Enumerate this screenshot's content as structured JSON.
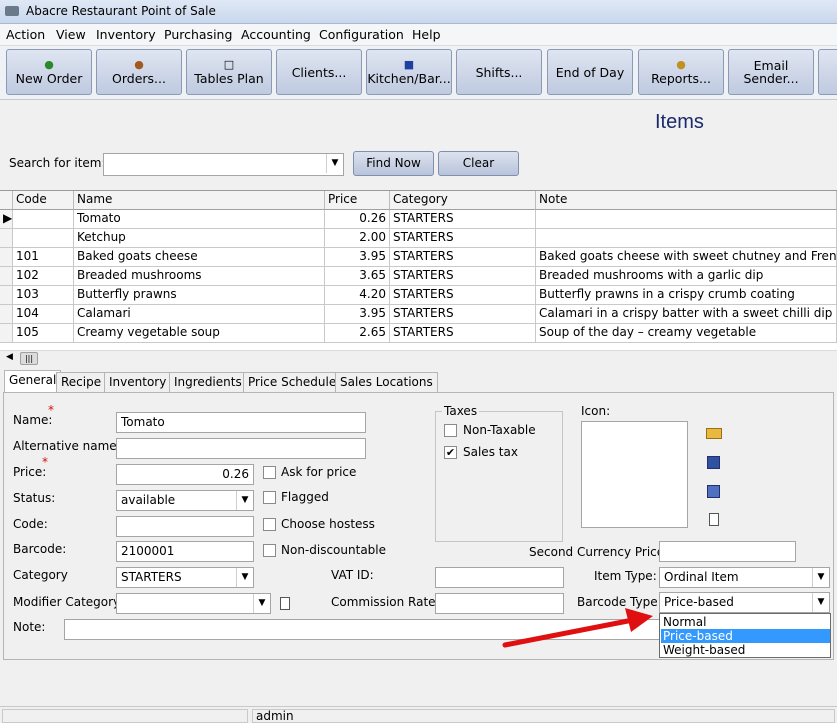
{
  "window": {
    "title": "Abacre Restaurant Point of Sale"
  },
  "menu": [
    "Action",
    "View",
    "Inventory",
    "Purchasing",
    "Accounting",
    "Configuration",
    "Help"
  ],
  "toolbar": [
    {
      "label": "New Order",
      "icon": "new-order-icon"
    },
    {
      "label": "Orders...",
      "icon": "orders-icon"
    },
    {
      "label": "Tables Plan",
      "icon": "tables-plan-icon"
    },
    {
      "label": "Clients...",
      "icon": ""
    },
    {
      "label": "Kitchen/Bar...",
      "icon": "kitchen-icon"
    },
    {
      "label": "Shifts...",
      "icon": ""
    },
    {
      "label": "End of Day",
      "icon": ""
    },
    {
      "label": "Reports...",
      "icon": "reports-icon"
    },
    {
      "label": "Email Sender...",
      "icon": ""
    }
  ],
  "page_title": "Items",
  "search": {
    "label": "Search for item:",
    "value": "",
    "find_label": "Find Now",
    "clear_label": "Clear"
  },
  "grid": {
    "columns": [
      "Code",
      "Name",
      "Price",
      "Category",
      "Note"
    ],
    "rows": [
      {
        "code": "",
        "name": "Tomato",
        "price": "0.26",
        "category": "STARTERS",
        "note": ""
      },
      {
        "code": "",
        "name": "Ketchup",
        "price": "2.00",
        "category": "STARTERS",
        "note": ""
      },
      {
        "code": "101",
        "name": "Baked goats cheese",
        "price": "3.95",
        "category": "STARTERS",
        "note": "Baked goats cheese with sweet chutney and French b"
      },
      {
        "code": "102",
        "name": "Breaded mushrooms",
        "price": "3.65",
        "category": "STARTERS",
        "note": "Breaded mushrooms with a garlic dip"
      },
      {
        "code": "103",
        "name": "Butterfly prawns",
        "price": "4.20",
        "category": "STARTERS",
        "note": "Butterfly prawns in a crispy crumb coating"
      },
      {
        "code": "104",
        "name": "Calamari",
        "price": "3.95",
        "category": "STARTERS",
        "note": "Calamari in a crispy batter with a sweet chilli dip"
      },
      {
        "code": "105",
        "name": "Creamy vegetable soup",
        "price": "2.65",
        "category": "STARTERS",
        "note": "Soup of the day – creamy vegetable"
      }
    ]
  },
  "tabs": [
    "General",
    "Recipe",
    "Inventory",
    "Ingredients",
    "Price Schedule",
    "Sales Locations"
  ],
  "form": {
    "name_label": "Name:",
    "name_value": "Tomato",
    "alt_name_label": "Alternative name:",
    "alt_name_value": "",
    "price_label": "Price:",
    "price_value": "0.26",
    "status_label": "Status:",
    "status_value": "available",
    "code_label": "Code:",
    "code_value": "",
    "barcode_label": "Barcode:",
    "barcode_value": "2100001",
    "category_label": "Category",
    "category_value": "STARTERS",
    "modifier_label": "Modifier Category:",
    "modifier_value": "",
    "note_label": "Note:",
    "note_value": "",
    "ask_price": "Ask for price",
    "flagged": "Flagged",
    "choose_hostess": "Choose hostess",
    "non_discountable": "Non-discountable",
    "taxes_label": "Taxes",
    "non_taxable": "Non-Taxable",
    "sales_tax": "Sales tax",
    "icon_label": "Icon:",
    "vat_label": "VAT ID:",
    "vat_value": "",
    "commission_label": "Commission Rate:",
    "commission_value": "",
    "second_currency_label": "Second Currency Price:",
    "second_currency_value": "",
    "item_type_label": "Item Type:",
    "item_type_value": "Ordinal Item",
    "barcode_type_label": "Barcode Type:",
    "barcode_type_value": "Price-based",
    "barcode_type_options": [
      "Normal",
      "Price-based",
      "Weight-based"
    ],
    "barcode_type_selected": 1
  },
  "status": {
    "user": "admin"
  },
  "colors": {
    "accent": "#1a2a6a",
    "selection": "#3399ff",
    "arrow": "#e01010"
  }
}
